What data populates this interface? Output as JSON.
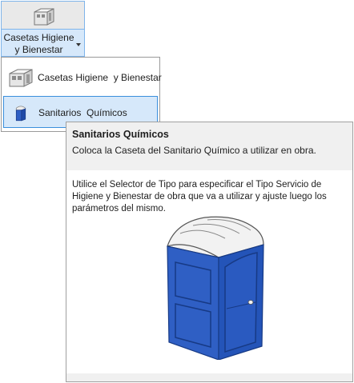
{
  "ribbon": {
    "button_label_line1": "Casetas Higiene",
    "button_label_line2": "y Bienestar",
    "icon": "cabin-icon"
  },
  "menu": {
    "items": [
      {
        "label": "Casetas Higiene  y Bienestar",
        "icon": "cabin-icon"
      },
      {
        "label": "Sanitarios  Químicos",
        "icon": "portable-toilet-icon"
      }
    ]
  },
  "tooltip": {
    "title": "Sanitarios Químicos",
    "subtitle": "Coloca la Caseta del Sanitario Químico a utilizar en obra.",
    "description": "Utilice el Selector de Tipo para especificar el Tipo Servicio de Higiene y Bienestar de obra que va a utilizar y ajuste luego los parámetros del mismo.",
    "illustration": "portable-toilet-illustration"
  },
  "colors": {
    "highlight": "#d6e8fa",
    "highlight_border": "#3a8fdc",
    "toilet_blue": "#2f5fc4",
    "roof_white": "#f2f2f2"
  }
}
